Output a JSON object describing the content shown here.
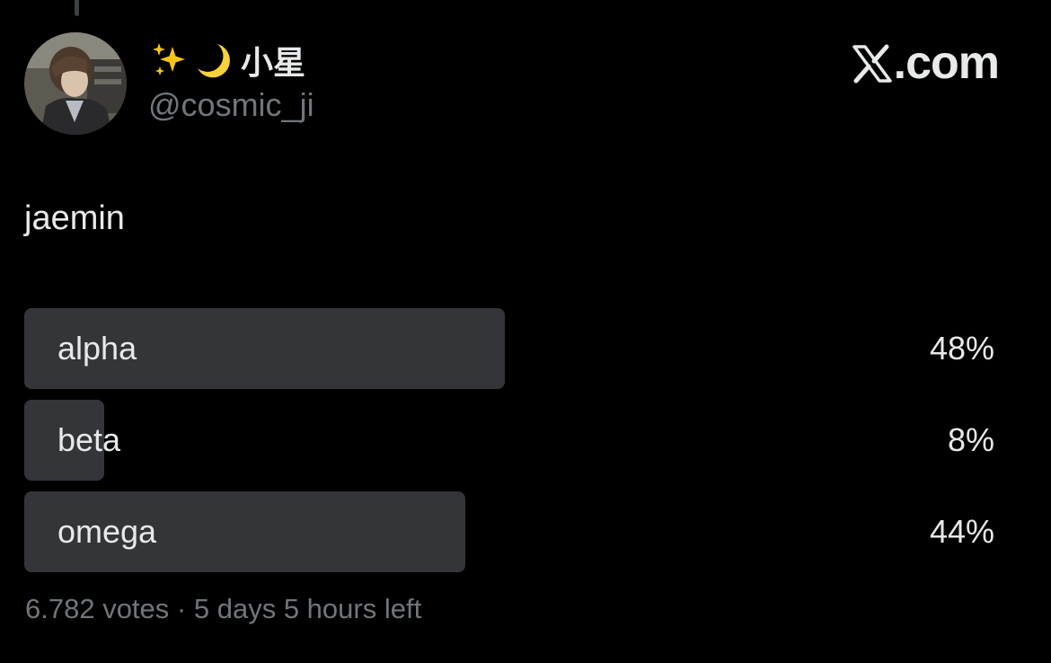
{
  "author": {
    "display_name_emojis": [
      "sparkles-icon",
      "crescent-moon-icon"
    ],
    "display_name": "小星",
    "handle": "@cosmic_ji"
  },
  "brand": {
    "icon": "x-logo-icon",
    "text": ".com"
  },
  "post": {
    "text": "jaemin"
  },
  "poll": {
    "options": [
      {
        "label": "alpha",
        "percent": "48%",
        "share": 0.48
      },
      {
        "label": "beta",
        "percent": "8%",
        "share": 0.08
      },
      {
        "label": "omega",
        "percent": "44%",
        "share": 0.44
      }
    ],
    "votes": "6.782 votes",
    "separator": "·",
    "time_left": "5 days 5 hours left"
  },
  "colors": {
    "background": "#000000",
    "primary_text": "#e7e9ea",
    "secondary_text": "#71767b",
    "poll_bar": "#333539",
    "sparkles": "#f5c518",
    "moon": "#f7d23a"
  }
}
